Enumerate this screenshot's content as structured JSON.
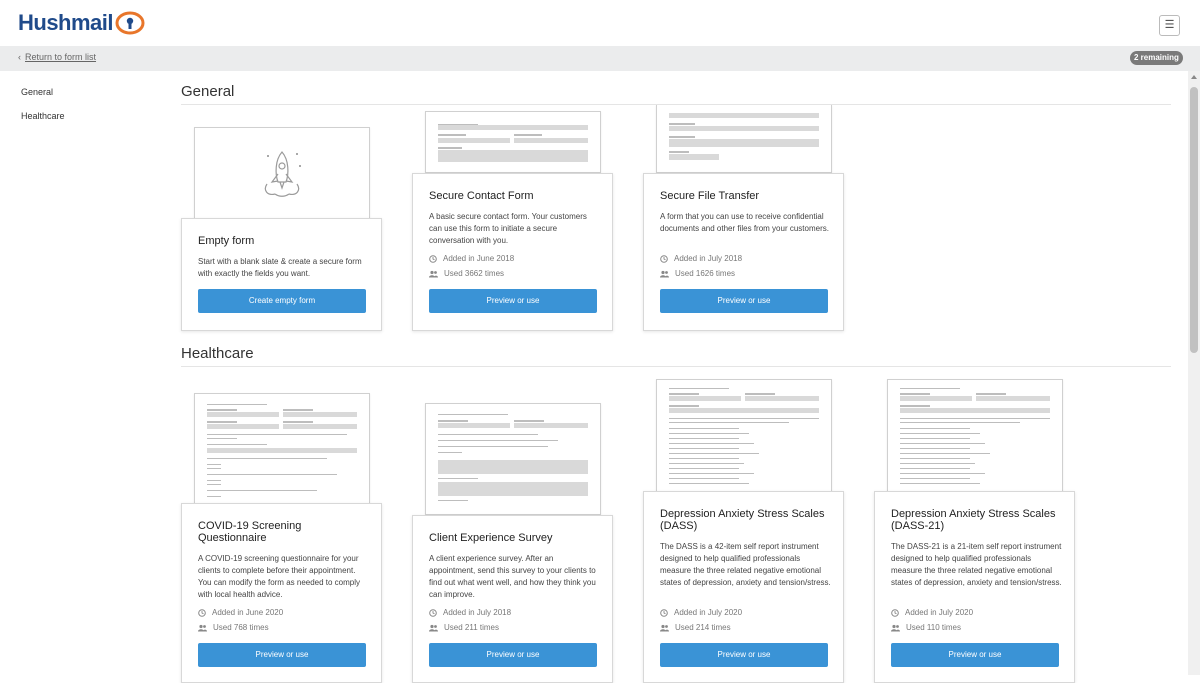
{
  "header": {
    "logo_text": "Hushmail",
    "menu_icon": "☰",
    "back_link": "Return to form list",
    "remaining_badge": "2 remaining"
  },
  "sidebar": {
    "items": [
      {
        "label": "General"
      },
      {
        "label": "Healthcare"
      }
    ]
  },
  "sections": {
    "general": {
      "title": "General"
    },
    "healthcare": {
      "title": "Healthcare"
    }
  },
  "cards": {
    "empty": {
      "title": "Empty form",
      "desc": "Start with a blank slate & create a secure form with exactly the fields you want.",
      "button": "Create empty form"
    },
    "contact": {
      "title": "Secure Contact Form",
      "desc": "A basic secure contact form. Your customers can use this form to initiate a secure conversation with you.",
      "added": "Added in June 2018",
      "used": "Used 3662 times",
      "button": "Preview or use"
    },
    "file": {
      "title": "Secure File Transfer",
      "desc": "A form that you can use to receive confidential documents and other files from your customers.",
      "added": "Added in July 2018",
      "used": "Used 1626 times",
      "button": "Preview or use"
    },
    "covid": {
      "title": "COVID-19 Screening Questionnaire",
      "desc": "A COVID-19 screening questionnaire for your clients to complete before their appointment. You can modify the form as needed to comply with local health advice.",
      "added": "Added in June 2020",
      "used": "Used 768 times",
      "button": "Preview or use"
    },
    "survey": {
      "title": "Client Experience Survey",
      "desc": "A client experience survey. After an appointment, send this survey to your clients to find out what went well, and how they think you can improve.",
      "added": "Added in July 2018",
      "used": "Used 211 times",
      "button": "Preview or use"
    },
    "dass": {
      "title": "Depression Anxiety Stress Scales (DASS)",
      "desc": "The DASS is a 42-item self report instrument designed to help qualified professionals measure the three related negative emotional states of depression, anxiety and tension/stress.",
      "added": "Added in July 2020",
      "used": "Used 214 times",
      "button": "Preview or use"
    },
    "dass21": {
      "title": "Depression Anxiety Stress Scales (DASS-21)",
      "desc": "The DASS-21 is a 21-item self report instrument designed to help qualified professionals measure the three related negative emotional states of depression, anxiety and tension/stress.",
      "added": "Added in July 2020",
      "used": "Used 110 times",
      "button": "Preview or use"
    }
  },
  "colors": {
    "accent": "#3a93d6",
    "logo": "#1f4a8a",
    "logo_ring": "#e8762b"
  }
}
